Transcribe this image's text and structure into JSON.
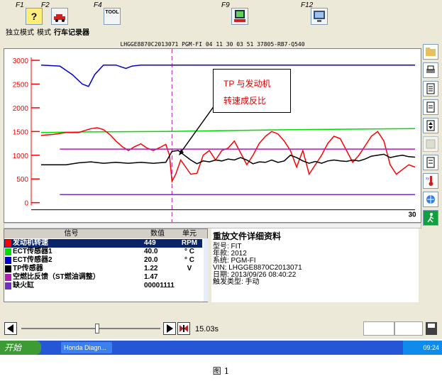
{
  "toolbar": {
    "keys": [
      {
        "label": "F1",
        "icon": "help-icon"
      },
      {
        "label": "F2",
        "icon": "car-icon"
      },
      {
        "label": "F4",
        "icon": "tool-icon",
        "icon_text": "TOOL"
      },
      {
        "label": "F9",
        "icon": "record-icon"
      },
      {
        "label": "F12",
        "icon": "screen-icon"
      }
    ]
  },
  "menubar": [
    "独立模式",
    "模式",
    "行车记录器"
  ],
  "chart_header": "LHGGE8870C2013071  PGM-FI  04 11 30 03 51  37805-RB7-Q540",
  "annotation": {
    "line1": "TP 与发动机",
    "line2": "转速成反比"
  },
  "chart_data": {
    "type": "line",
    "yticks": [
      0,
      500,
      1000,
      1500,
      2000,
      2500,
      3000
    ],
    "ylim": [
      -80,
      3150
    ],
    "xlim": [
      0,
      30
    ],
    "xtick_label": "30",
    "cursor_x": 10.5,
    "grid": false,
    "colors": {
      "axis": "#ff0000",
      "cursor": "#c040c0"
    },
    "series": [
      {
        "color": "#0000cc",
        "points": [
          [
            0,
            2900
          ],
          [
            1.5,
            2880
          ],
          [
            2.5,
            2700
          ],
          [
            3.3,
            2500
          ],
          [
            3.8,
            2450
          ],
          [
            4.3,
            2700
          ],
          [
            5,
            2900
          ],
          [
            6,
            2900
          ],
          [
            6.8,
            2830
          ],
          [
            7.3,
            2880
          ],
          [
            8,
            2900
          ],
          [
            22,
            2900
          ],
          [
            30,
            2900
          ]
        ]
      },
      {
        "color": "#00dd00",
        "points": [
          [
            0,
            1480
          ],
          [
            3,
            1490
          ],
          [
            10,
            1500
          ],
          [
            15,
            1520
          ],
          [
            20,
            1540
          ],
          [
            30,
            1560
          ]
        ]
      },
      {
        "color": "#ff0000",
        "points": [
          [
            0,
            1420
          ],
          [
            1,
            1440
          ],
          [
            2,
            1480
          ],
          [
            3,
            1480
          ],
          [
            4,
            1560
          ],
          [
            4.5,
            1580
          ],
          [
            5,
            1540
          ],
          [
            5.5,
            1440
          ],
          [
            6,
            1300
          ],
          [
            6.5,
            1180
          ],
          [
            7,
            1100
          ],
          [
            7.5,
            1180
          ],
          [
            8,
            1240
          ],
          [
            8.5,
            1150
          ],
          [
            9,
            1100
          ],
          [
            9.5,
            1160
          ],
          [
            10,
            1230
          ],
          [
            10.3,
            1000
          ],
          [
            10.5,
            450
          ],
          [
            10.8,
            600
          ],
          [
            11.2,
            900
          ],
          [
            11.6,
            750
          ],
          [
            12,
            600
          ],
          [
            12.5,
            620
          ],
          [
            13,
            1000
          ],
          [
            13.5,
            1100
          ],
          [
            14,
            900
          ],
          [
            14.5,
            1100
          ],
          [
            15,
            1150
          ],
          [
            15.5,
            1300
          ],
          [
            16,
            1050
          ],
          [
            16.5,
            800
          ],
          [
            17,
            1000
          ],
          [
            17.5,
            1250
          ],
          [
            18,
            1400
          ],
          [
            18.5,
            1500
          ],
          [
            19,
            1450
          ],
          [
            19.5,
            1300
          ],
          [
            20,
            1100
          ],
          [
            20.5,
            750
          ],
          [
            21,
            1100
          ],
          [
            21.5,
            600
          ],
          [
            22,
            800
          ],
          [
            22.5,
            1000
          ],
          [
            23,
            1250
          ],
          [
            23.5,
            1400
          ],
          [
            24,
            1350
          ],
          [
            24.5,
            1100
          ],
          [
            25,
            850
          ],
          [
            25.5,
            1000
          ],
          [
            26,
            1200
          ],
          [
            26.5,
            1400
          ],
          [
            27,
            1500
          ],
          [
            27.5,
            1300
          ],
          [
            28,
            800
          ],
          [
            28.5,
            600
          ],
          [
            29,
            700
          ],
          [
            29.5,
            800
          ],
          [
            30,
            750
          ]
        ]
      },
      {
        "color": "#000000",
        "points": [
          [
            0,
            800
          ],
          [
            2,
            800
          ],
          [
            3,
            840
          ],
          [
            4,
            860
          ],
          [
            5,
            830
          ],
          [
            6,
            850
          ],
          [
            7,
            830
          ],
          [
            8,
            850
          ],
          [
            9,
            830
          ],
          [
            10,
            850
          ],
          [
            10.5,
            1080
          ],
          [
            11,
            1100
          ],
          [
            11.5,
            1000
          ],
          [
            12,
            900
          ],
          [
            12.5,
            820
          ],
          [
            13,
            880
          ],
          [
            13.5,
            860
          ],
          [
            14,
            900
          ],
          [
            14.5,
            880
          ],
          [
            15,
            920
          ],
          [
            15.5,
            900
          ],
          [
            16,
            950
          ],
          [
            16.5,
            900
          ],
          [
            17,
            820
          ],
          [
            17.5,
            860
          ],
          [
            18,
            850
          ],
          [
            18.5,
            900
          ],
          [
            19,
            850
          ],
          [
            19.5,
            880
          ],
          [
            20,
            1000
          ],
          [
            20.5,
            950
          ],
          [
            21,
            880
          ],
          [
            21.5,
            830
          ],
          [
            22,
            870
          ],
          [
            22.5,
            830
          ],
          [
            23,
            880
          ],
          [
            23.5,
            900
          ],
          [
            24,
            880
          ],
          [
            24.5,
            870
          ],
          [
            25,
            900
          ],
          [
            25.5,
            880
          ],
          [
            26,
            920
          ],
          [
            26.5,
            980
          ],
          [
            27,
            1000
          ],
          [
            27.5,
            1020
          ],
          [
            28,
            950
          ],
          [
            28.5,
            980
          ],
          [
            29,
            1000
          ],
          [
            29.5,
            970
          ],
          [
            30,
            960
          ]
        ]
      },
      {
        "color": "#b020b0",
        "points": [
          [
            1.5,
            1130
          ],
          [
            30,
            1130
          ]
        ]
      },
      {
        "color": "#7030c0",
        "points": [
          [
            1.5,
            170
          ],
          [
            30,
            170
          ]
        ]
      }
    ]
  },
  "table": {
    "headers": [
      "信号",
      "数值",
      "单元"
    ],
    "rows": [
      {
        "name": "发动机转速",
        "value": "449",
        "unit": "RPM",
        "color": "#ff0000",
        "selected": true
      },
      {
        "name": "ECT传感器1",
        "value": "40.0",
        "unit": "° C",
        "color": "#00dd00",
        "selected": false
      },
      {
        "name": "ECT传感器2",
        "value": "20.0",
        "unit": "° C",
        "color": "#0000cc",
        "selected": false
      },
      {
        "name": "TP传感器",
        "value": "1.22",
        "unit": "V",
        "color": "#000000",
        "selected": false
      },
      {
        "name": "空燃比反馈（ST燃油调整）",
        "value": "1.47",
        "unit": "",
        "color": "#b020b0",
        "selected": false
      },
      {
        "name": "缺火缸",
        "value": "00001111",
        "unit": "",
        "color": "#7030c0",
        "selected": false
      }
    ]
  },
  "detail": {
    "title": "重放文件详细资料",
    "lines": [
      "型号: FIT",
      "年款: 2012",
      "系统: PGM-FI",
      "VIN: LHGGE8870C2013071",
      "日期: 2013/09/26 08:40:22",
      "触发类型: 手动"
    ]
  },
  "playback": {
    "time": "15.03s"
  },
  "taskbar": {
    "start": "开始",
    "task": "Honda Diagn...",
    "clock": "09:24"
  },
  "caption": "图 1"
}
